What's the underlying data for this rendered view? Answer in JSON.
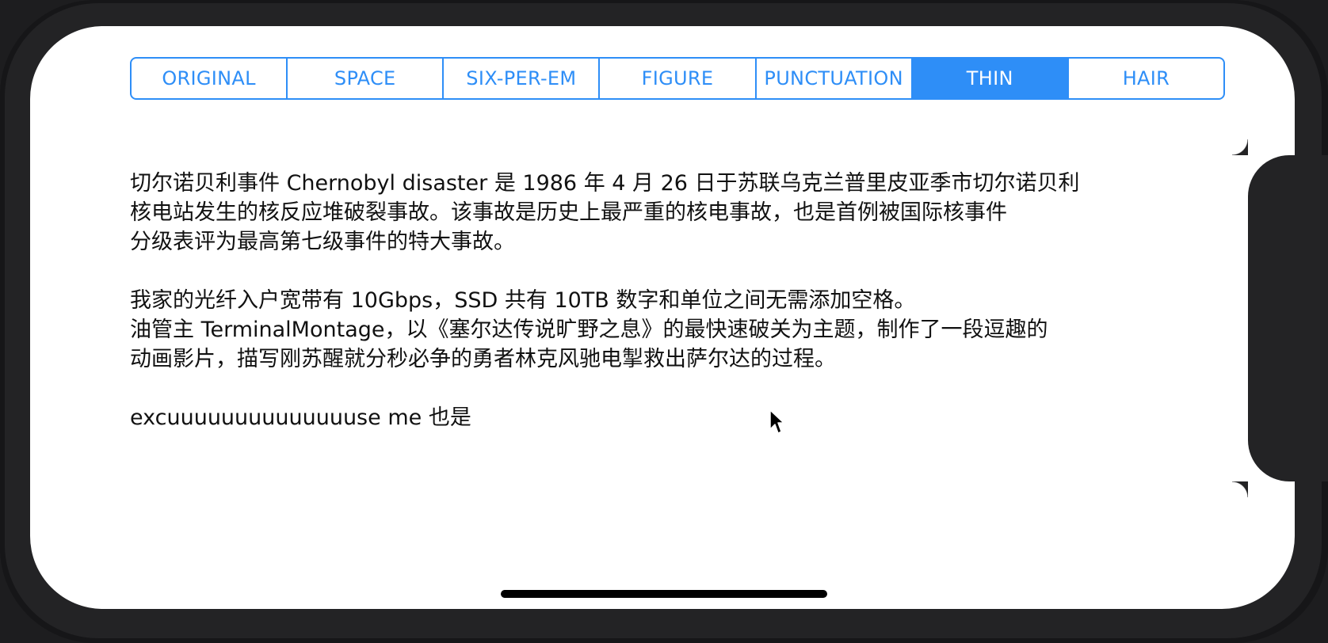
{
  "segmented_control": {
    "selected_index": 5,
    "options": [
      {
        "label": "ORIGINAL"
      },
      {
        "label": "SPACE"
      },
      {
        "label": "SIX-PER-EM"
      },
      {
        "label": "FIGURE"
      },
      {
        "label": "PUNCTUATION"
      },
      {
        "label": "THIN"
      },
      {
        "label": "HAIR"
      }
    ]
  },
  "text": {
    "paragraph_1": "切尔诺贝利事件 Chernobyl disaster 是 1986 年 4 月 26 日于苏联乌克兰普里皮亚季市切尔诺贝利\n核电站发生的核反应堆破裂事故。该事故是历史上最严重的核电事故，也是首例被国际核事件\n分级表评为最高第七级事件的特大事故。",
    "paragraph_2": "我家的光纤入户宽带有 10Gbps，SSD 共有 10TB 数字和单位之间无需添加空格。",
    "paragraph_3": "油管主 TerminalMontage，以《塞尔达传说旷野之息》的最快速破关为主题，制作了一段逗趣的\n动画影片，描写刚苏醒就分秒必争的勇者林克风驰电掣救出萨尔达的过程。",
    "paragraph_4": "excuuuuuuuuuuuuuuse me 也是"
  },
  "colors": {
    "accent": "#2e8ef7",
    "text": "#111111",
    "background": "#ffffff"
  },
  "icons": {
    "cursor": "mouse-pointer-icon"
  }
}
